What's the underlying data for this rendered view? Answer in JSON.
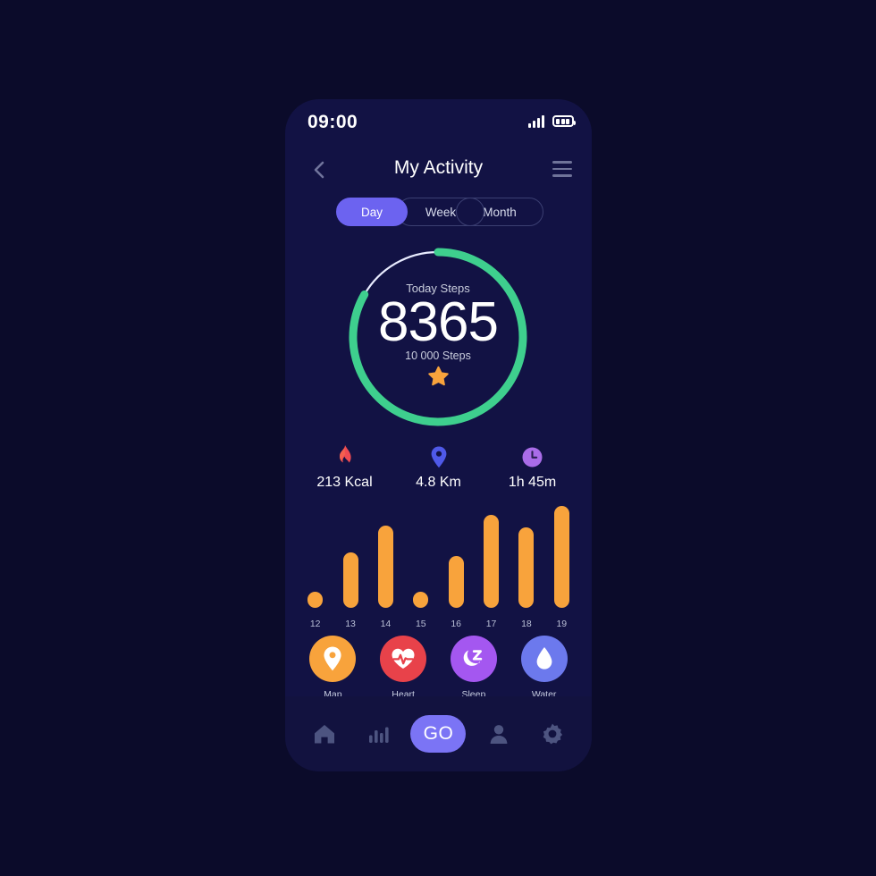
{
  "theme": {
    "page_bg": "#0b0b2a",
    "screen_bg": "#121244",
    "accent": "#6c63f0",
    "ring_progress": "#3ecf8e",
    "ring_track": "#e9ecff",
    "bar_color": "#f8a33c",
    "muted_text": "#c9cddd"
  },
  "status_bar": {
    "time": "09:00",
    "signal_icon": "signal-bars-icon",
    "battery_icon": "battery-icon"
  },
  "header": {
    "back_icon": "chevron-left-icon",
    "title": "My Activity",
    "menu_icon": "hamburger-menu-icon"
  },
  "tabs": [
    {
      "label": "Day",
      "active": true
    },
    {
      "label": "Week",
      "active": false
    },
    {
      "label": "Month",
      "active": false
    }
  ],
  "ring": {
    "label": "Today Steps",
    "value": "8365",
    "goal": "10 000 Steps",
    "badge_icon": "star-icon",
    "percent": 83
  },
  "stats": [
    {
      "icon": "flame-icon",
      "value": "213 Kcal",
      "color": "#ef4b52"
    },
    {
      "icon": "map-pin-icon",
      "value": "4.8 Km",
      "color": "#4f59e8"
    },
    {
      "icon": "clock-icon",
      "value": "1h 45m",
      "color": "#a96ce8"
    }
  ],
  "quick_actions": [
    {
      "label": "Map",
      "icon": "map-pin-icon",
      "color": "#f8a33c"
    },
    {
      "label": "Heart",
      "icon": "heart-pulse-icon",
      "color": "#e8424a"
    },
    {
      "label": "Sleep",
      "icon": "moon-sleep-icon",
      "color": "#a457f0"
    },
    {
      "label": "Water",
      "icon": "water-drop-icon",
      "color": "#6c79ed"
    }
  ],
  "bottom_nav": [
    {
      "icon": "home-icon",
      "label": ""
    },
    {
      "icon": "bar-chart-icon",
      "label": ""
    },
    {
      "icon": "go-button",
      "label": "GO"
    },
    {
      "icon": "person-icon",
      "label": ""
    },
    {
      "icon": "gear-icon",
      "label": ""
    }
  ],
  "chart_data": {
    "type": "bar",
    "title": "",
    "xlabel": "",
    "ylabel": "",
    "categories": [
      "12",
      "13",
      "14",
      "15",
      "16",
      "17",
      "18",
      "19"
    ],
    "values": [
      18,
      62,
      92,
      18,
      58,
      104,
      90,
      114
    ],
    "ylim": [
      0,
      119
    ],
    "grid": false,
    "legend": "none"
  }
}
